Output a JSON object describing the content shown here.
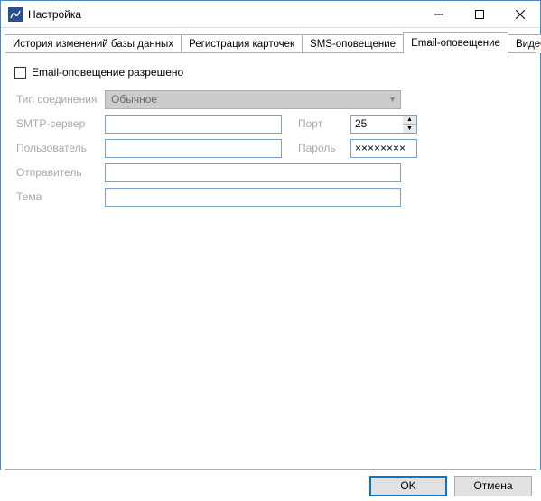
{
  "window": {
    "title": "Настройка"
  },
  "tabs": {
    "t0": "История изменений базы данных",
    "t1": "Регистрация карточек",
    "t2": "SMS-оповещение",
    "t3": "Email-оповещение",
    "t4": "Видео"
  },
  "form": {
    "enable_label": "Email-оповещение разрешено",
    "conn_type_label": "Тип соединения",
    "conn_type_value": "Обычное",
    "smtp_label": "SMTP-сервер",
    "smtp_value": "",
    "port_label": "Порт",
    "port_value": "25",
    "user_label": "Пользователь",
    "user_value": "",
    "pass_label": "Пароль",
    "pass_value": "××××××××",
    "sender_label": "Отправитель",
    "sender_value": "",
    "subject_label": "Тема",
    "subject_value": ""
  },
  "buttons": {
    "ok": "OK",
    "cancel": "Отмена"
  }
}
